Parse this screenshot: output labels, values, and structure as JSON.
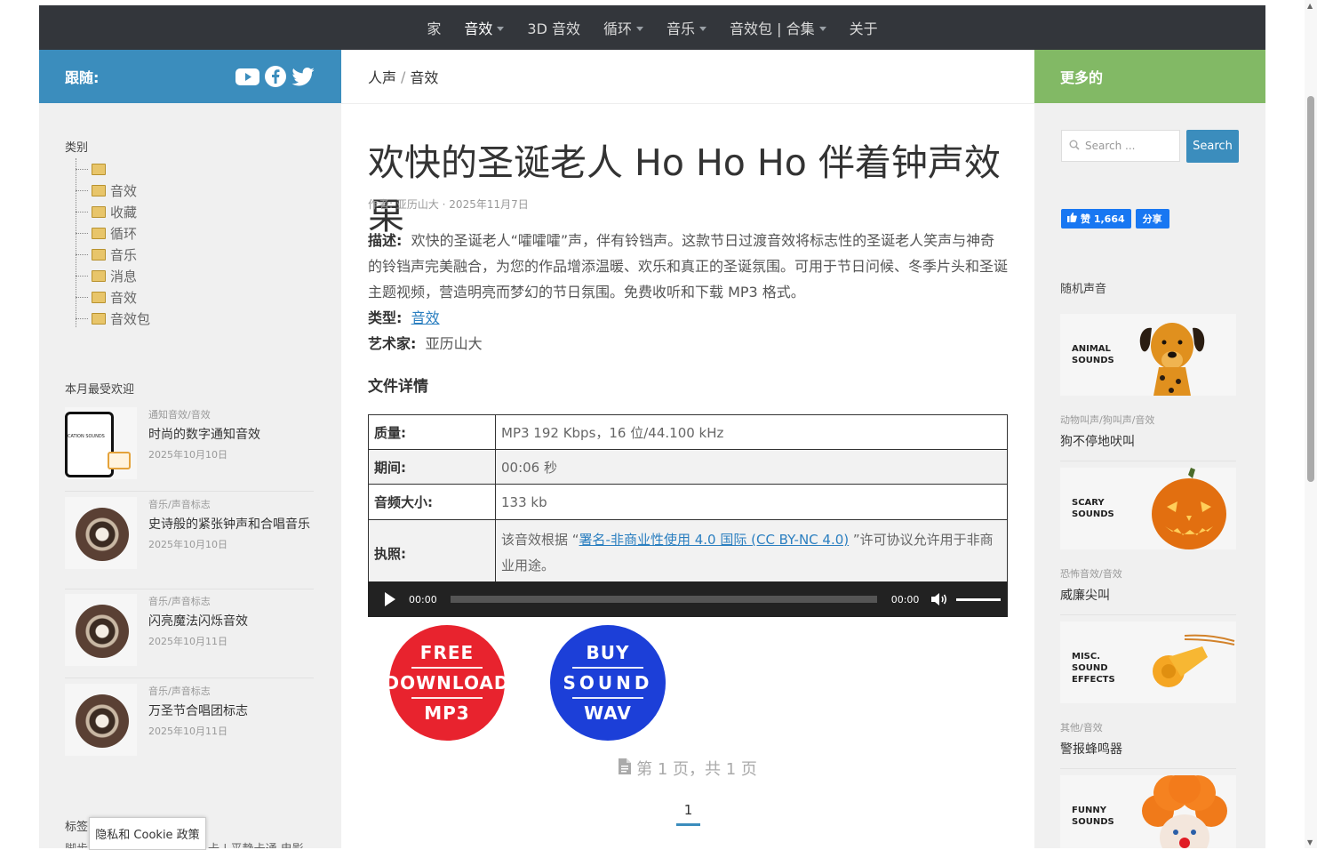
{
  "nav": {
    "items": [
      {
        "label": "家",
        "caret": false,
        "active": false
      },
      {
        "label": "音效",
        "caret": true,
        "active": true
      },
      {
        "label": "3D 音效",
        "caret": false,
        "active": false
      },
      {
        "label": "循环",
        "caret": true,
        "active": false
      },
      {
        "label": "音乐",
        "caret": true,
        "active": false
      },
      {
        "label": "音效包 | 合集",
        "caret": true,
        "active": false
      },
      {
        "label": "关于",
        "caret": false,
        "active": false
      }
    ]
  },
  "left": {
    "follow_label": "跟随:",
    "social_icons": [
      "youtube-icon",
      "facebook-icon",
      "twitter-icon"
    ],
    "categories_title": "类别",
    "categories": [
      "",
      "音效",
      "收藏",
      "循环",
      "音乐",
      "消息",
      "音效",
      "音效包"
    ],
    "popular_title": "本月最受欢迎",
    "popular": [
      {
        "category": "通知音效/音效",
        "title": "时尚的数字通知音效",
        "date": "2025年10月10日",
        "thumb_text": "CATION SOUNDS"
      },
      {
        "category": "音乐/声音标志",
        "title": "史诗般的紧张钟声和合唱音乐",
        "date": "2025年10月10日"
      },
      {
        "category": "音乐/声音标志",
        "title": "闪亮魔法闪烁音效",
        "date": "2025年10月11日"
      },
      {
        "category": "音乐/声音标志",
        "title": "万圣节合唱团标志",
        "date": "2025年10月11日"
      }
    ],
    "tags_title": "标签",
    "tags_snippet_left": "脚步",
    "tags_snippet_right": "卡 | 平静卡通 电影"
  },
  "main": {
    "breadcrumb": [
      "人声",
      "音效"
    ],
    "title": "欢快的圣诞老人 Ho Ho Ho 伴着钟声效果",
    "meta": "作者: 亚历山大 · 2025年11月7日",
    "desc_label": "描述:",
    "desc_text": "欢快的圣诞老人“嚯嚯嚯”声，伴有铃铛声。这款节日过渡音效将标志性的圣诞老人笑声与神奇的铃铛声完美融合，为您的作品增添温暖、欢乐和真正的圣诞氛围。可用于节日问候、冬季片头和圣诞主题视频，营造明亮而梦幻的节日氛围。免费收听和下载 MP3 格式。",
    "type_label": "类型:",
    "type_value": "音效",
    "artist_label": "艺术家:",
    "artist_value": "亚历山大",
    "details_title": "文件详情",
    "specs": {
      "quality_label": "质量:",
      "quality_value": "MP3 192 Kbps，16 位/44.100 kHz",
      "duration_label": "期间:",
      "duration_value": "00:06 秒",
      "size_label": "音频大小:",
      "size_value": "133 kb",
      "license_label": "执照:",
      "license_before": "该音效根据 “",
      "license_link": "署名-非商业性使用 4.0 国际 (CC BY-NC 4.0)",
      "license_after": " ”许可协议允许用于非商业用途。"
    },
    "player": {
      "current": "00:00",
      "total": "00:00",
      "progress": 0,
      "volume": 1.0
    },
    "free_btn": [
      "FREE",
      "DOWNLOAD",
      "MP3"
    ],
    "buy_btn": [
      "BUY",
      "SOUND",
      "WAV"
    ],
    "page_info": "第 1 页，共 1 页",
    "page_number": "1"
  },
  "right": {
    "more_label": "更多的",
    "search_placeholder": "Search ...",
    "search_button": "Search",
    "fb_like": "赞 1,664",
    "fb_share": "分享",
    "random_title": "随机声音",
    "random": [
      {
        "label1": "ANIMAL",
        "label2": "SOUNDS",
        "label3": "",
        "category": "动物叫声/狗叫声/音效",
        "title": "狗不停地吠叫"
      },
      {
        "label1": "SCARY",
        "label2": "SOUNDS",
        "label3": "",
        "category": "恐怖音效/音效",
        "title": "威廉尖叫"
      },
      {
        "label1": "MISC.",
        "label2": "SOUND",
        "label3": "EFFECTS",
        "category": "其他/音效",
        "title": "警报蜂鸣器"
      },
      {
        "label1": "FUNNY",
        "label2": "SOUNDS",
        "label3": "",
        "category": "",
        "title": ""
      }
    ]
  },
  "cookie": "隐私和 Cookie 政策",
  "colors": {
    "nav_bg": "#33363b",
    "follow_bg": "#3b8dbd",
    "more_bg": "#82b965",
    "free_btn": "#e8232e",
    "buy_btn": "#1c3fd8",
    "link": "#2b7fc0"
  }
}
